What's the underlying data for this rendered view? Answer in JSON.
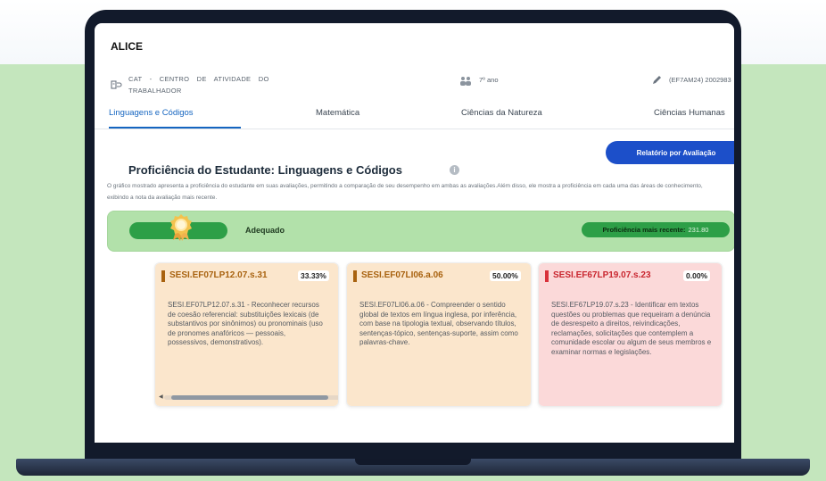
{
  "user": {
    "name": "ALICE"
  },
  "info": {
    "school": "CAT - CENTRO DE ATIVIDADE DO TRABALHADOR",
    "grade": "7º ano",
    "class": "(EF7AM24) 2002983"
  },
  "tabs": [
    {
      "label": "Linguagens e Códigos",
      "active": true
    },
    {
      "label": "Matemática",
      "active": false
    },
    {
      "label": "Ciências da Natureza",
      "active": false
    },
    {
      "label": "Ciências Humanas",
      "active": false
    }
  ],
  "report_button": "Relatório por Avaliação",
  "section": {
    "title": "Proficiência do Estudante: Linguagens e Códigos",
    "info_glyph": "i",
    "description": "O gráfico mostrado apresenta a proficiência do estudante em suas avaliações, permitindo a comparação de seu desempenho em ambas as avaliações.Além disso, ele mostra a proficiência em cada uma das áreas de conhecimento, exibindo a nota da avaliação mais recente."
  },
  "proficiency": {
    "level": "Adequado",
    "recent_label": "Proficiência mais recente:",
    "recent_value": "231.80"
  },
  "cards": [
    {
      "code": "SESI.EF07LP12.07.s.31",
      "percent": "33.33%",
      "text": "SESI.EF07LP12.07.s.31 - Reconhecer recursos de coesão referencial: substituições lexicais (de substantivos por sinônimos) ou pronominais (uso de pronomes anafóricos — pessoais, possessivos, demonstrativos).",
      "bar_color": "#a8620f",
      "code_color": "#a8620f",
      "bg_color": "#fbe6cc"
    },
    {
      "code": "SESI.EF07LI06.a.06",
      "percent": "50.00%",
      "text": "SESI.EF07LI06.a.06 - Compreender o sentido global de textos em língua inglesa, por inferência, com base na tipologia textual, observando títulos, sentenças-tópico, sentenças-suporte, assim como palavras-chave.",
      "bar_color": "#a8620f",
      "code_color": "#a8620f",
      "bg_color": "#fbe6cc"
    },
    {
      "code": "SESI.EF67LP19.07.s.23",
      "percent": "0.00%",
      "text": "SESI.EF67LP19.07.s.23 - Identificar em textos questões ou problemas que requeiram a denúncia de desrespeito a direitos, reivindicações, reclamações, solicitações que contemplem a comunidade escolar ou algum de seus membros e examinar normas e legislações.",
      "bar_color": "#d9313b",
      "code_color": "#c9262f",
      "bg_color": "#fbd9d9"
    }
  ],
  "colors": {
    "primary": "#1c4fc9",
    "tab_active": "#1565c0",
    "level_green": "#2d9f47",
    "level_bg": "#b2e1aa",
    "page_green": "#c4e6bd"
  },
  "icons": {
    "school": "school-icon",
    "grade": "students-icon",
    "class": "pencil-icon",
    "medal": "medal-icon",
    "info": "info-icon"
  }
}
